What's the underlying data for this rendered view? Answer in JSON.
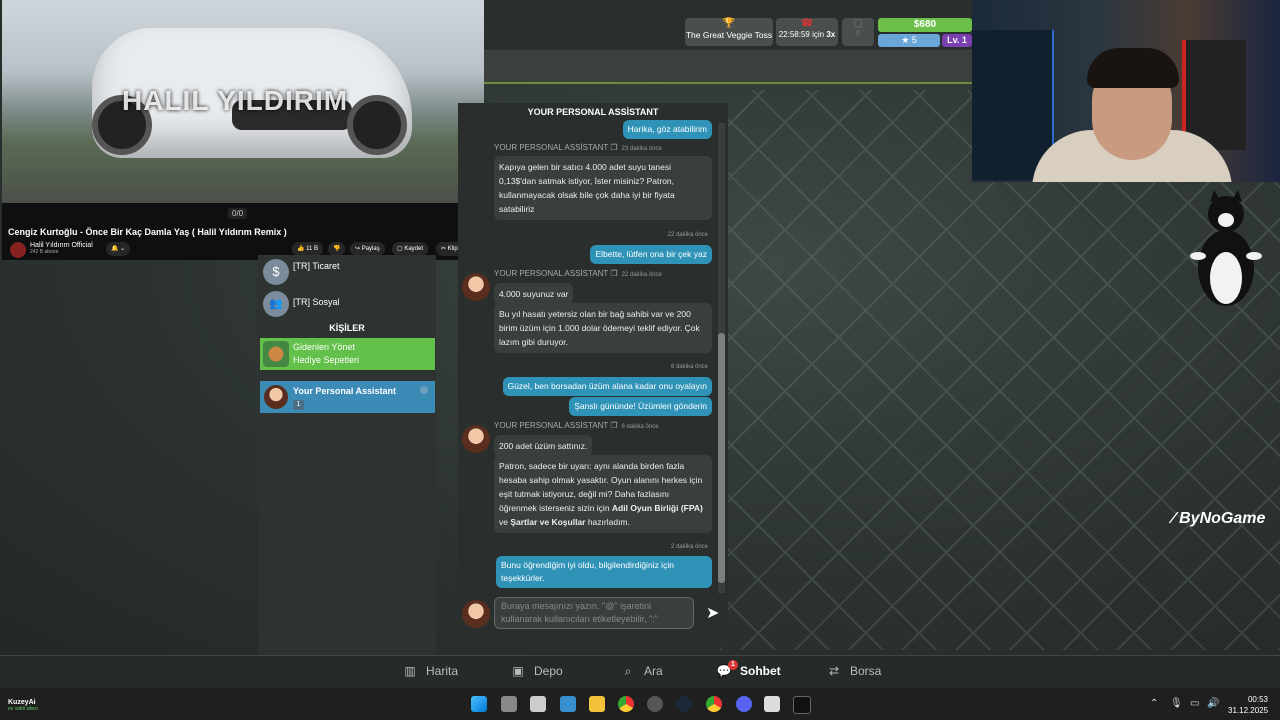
{
  "topbar": {
    "event_label": "The Great Veggie Toss",
    "timer_label": "22:58:59 için",
    "timer_mult": "3x",
    "money": "$680",
    "xp": "5",
    "level": "Lv. 1",
    "counter": "0"
  },
  "video": {
    "watermark": "HALIL YILDIRIM",
    "title": "Cengiz Kurtoğlu - Önce Bir Kaç Damla Yaş ( Halil Yıldırım Remix )",
    "channel": "Halil Yıldırım Official",
    "subs": "242 B abone",
    "likes": "11 B",
    "share": "Paylaş",
    "save": "Kaydet",
    "clip": "Klip",
    "counter": "0/0"
  },
  "sidebar": {
    "items": [
      {
        "label": "[TR] Ticaret",
        "icon": "$"
      },
      {
        "label": "[TR] Sosyal",
        "icon": "👥"
      }
    ],
    "section_title": "KİŞİLER",
    "gift": {
      "line1": "Gidenleri Yönet",
      "line2": "Hediye Sepetleri"
    },
    "assistant": {
      "name": "Your Personal Assistant",
      "count": "1"
    }
  },
  "chat": {
    "title": "YOUR PERSONAL ASSİSTANT",
    "sender": "YOUR PERSONAL ASSİSTANT",
    "m1": "Harika, göz atabilirim",
    "meta1": "23 dakika önce",
    "m2": "Kapıya gelen bir satıcı 4.000 adet suyu tanesi 0,13$'dan satmak istiyor, İster misiniz? Patron, kullanmayacak olsak bile çok daha iyi bir fiyata satabiliriz",
    "stamp1": "22 dakika önce",
    "m3": "Elbette, lütfen ona bir çek yaz",
    "meta2": "22 dakika önce",
    "m4": "4.000 suyunuz var",
    "m5": "Bu yıl hasatı yetersiz olan bir bağ sahibi var ve 200 birim üzüm için 1.000 dolar ödemeyi teklif ediyor. Çok lazım gibi duruyor.",
    "stamp2": "6 dakika önce",
    "m6": "Güzel, ben borsadan üzüm alana kadar onu oyalayın",
    "m7": "Şanslı gününde! Üzümleri gönderin",
    "meta3": "6 dakika önce",
    "m8": "200 adet üzüm sattınız.",
    "m9a": "Patron, sadece bir uyarı: aynı alanda birden fazla hesaba sahip olmak yasaktır. Oyun alanını herkes için eşit tutmak istiyoruz, değil mi? Daha fazlasını öğrenmek isterseniz sizin için ",
    "m9b": "Adil Oyun Birliği (FPA)",
    "m9c": " ve ",
    "m9d": "Şartlar ve Koşullar",
    "m9e": " hazırladım.",
    "stamp3": "2 dakika önce",
    "m10": "Bunu öğrendiğim iyi oldu, bilgilendirdiğiniz için teşekkürler.",
    "input_placeholder": "Buraya mesajınızı yazın. \"@\" işaretini kullanarak kullanıcıları etiketleyebilir, \":\""
  },
  "brand": "ByNoGame",
  "nav": {
    "map": "Harita",
    "depot": "Depo",
    "search": "Ara",
    "chat": "Sohbet",
    "chat_badge": "1",
    "exchange": "Borsa"
  },
  "taskbar": {
    "user": "KuzeyAi",
    "user_sub": "ev vakti sitesi",
    "time": "00:53",
    "date": "31.12.2025"
  }
}
